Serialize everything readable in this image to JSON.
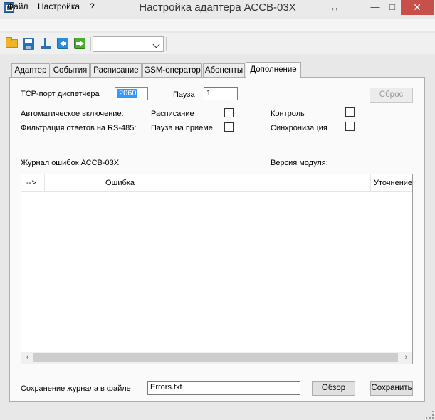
{
  "window": {
    "title": "Настройка адаптера АССВ-03Х",
    "minimize": "—",
    "maximize": "□",
    "close": "✕",
    "resize": "↔"
  },
  "menu": {
    "file": "Файл",
    "settings": "Настройка",
    "help": "?"
  },
  "toolbar": {
    "select_value": "",
    "icons": [
      "folder-open-icon",
      "save-icon",
      "upload-icon",
      "back-icon",
      "forward-icon"
    ]
  },
  "tabs": [
    {
      "label": "Адаптер"
    },
    {
      "label": "События"
    },
    {
      "label": "Расписание"
    },
    {
      "label": "GSM-оператор"
    },
    {
      "label": "Абоненты"
    },
    {
      "label": "Дополнение",
      "active": true
    }
  ],
  "panel": {
    "tcp_port_label": "TCP-порт диспетчера",
    "tcp_port_value": "2060",
    "pause_label": "Пауза",
    "pause_value": "1",
    "reset_button": "Сброс",
    "auto_enable_label": "Автоматическое включение:",
    "schedule_label": "Расписание",
    "schedule_checked": false,
    "control_label": "Контроль",
    "control_checked": false,
    "filter_label": "Фильтрация ответов на RS-485:",
    "pause_receive_label": "Пауза на приеме",
    "pause_receive_checked": false,
    "sync_label": "Синхронизация",
    "sync_checked": false,
    "error_log_label": "Журнал ошибок АССВ-03Х",
    "module_version_label": "Версия модуля:",
    "columns": [
      "-->",
      "Ошибка",
      "Уточнение"
    ],
    "rows": [],
    "save_log_label": "Сохранение журнала в файле",
    "log_file_value": "Errors.txt",
    "browse_button": "Обзор",
    "save_button": "Сохранить"
  }
}
